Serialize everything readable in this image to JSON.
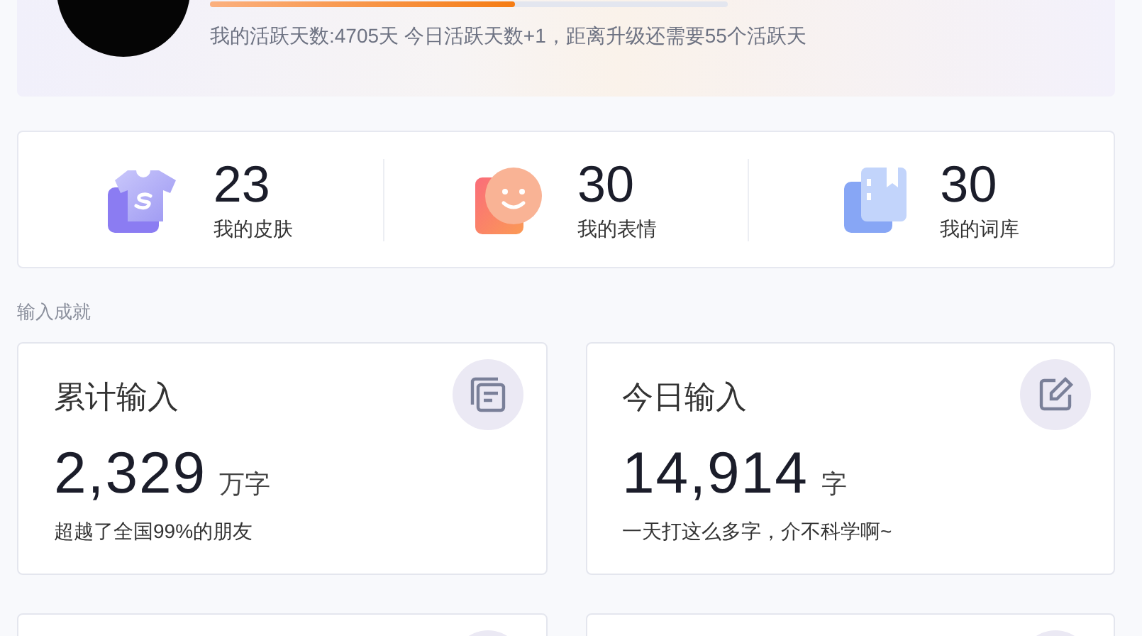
{
  "profile": {
    "progress": {
      "level": 0.59
    },
    "activity_text": "我的活跃天数:4705天 今日活跃天数+1，距离升级还需要55个活跃天"
  },
  "stats": [
    {
      "kind": "skin",
      "value": "23",
      "label": "我的皮肤"
    },
    {
      "kind": "emoji",
      "value": "30",
      "label": "我的表情"
    },
    {
      "kind": "lexicon",
      "value": "30",
      "label": "我的词库"
    }
  ],
  "section_title": "输入成就",
  "achievements": [
    {
      "kind": "total",
      "title": "累计输入",
      "value": "2,329",
      "unit": "万字",
      "note": "超越了全国99%的朋友"
    },
    {
      "kind": "today",
      "title": "今日输入",
      "value": "14,914",
      "unit": "字",
      "note": "一天打这么多字，介不科学啊~"
    }
  ]
}
